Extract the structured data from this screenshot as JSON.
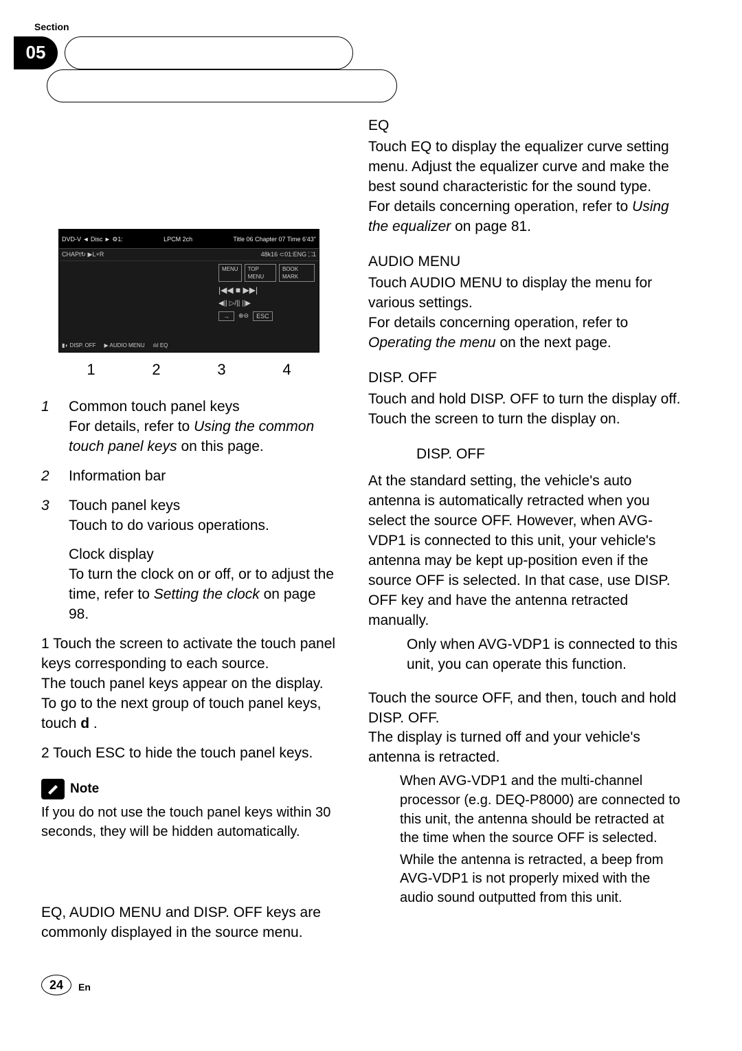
{
  "section_label": "Section",
  "section_number": "05",
  "labels": {
    "n1": "1",
    "n2": "2",
    "n3": "3",
    "n4": "4"
  },
  "left": {
    "l1_num": "1",
    "l1_line1": "Common touch panel keys",
    "l1_line2a": "For details, refer to ",
    "l1_line2b": "Using the common touch panel keys",
    "l1_line2c": " on this page.",
    "l2_num": "2",
    "l2": "Information bar",
    "l3_num": "3",
    "l3_line1": "Touch panel keys",
    "l3_line2": "Touch to do various operations.",
    "l4_line1": "Clock display",
    "l4_line2a": "To turn the clock on or off, or to adjust the time, refer to ",
    "l4_line2b": "Setting the clock",
    "l4_line2c": " on page 98.",
    "p1_a": "1    Touch the screen to activate the touch panel keys corresponding to each source.",
    "p1_b": "The touch panel keys appear on the display.",
    "p1_c_a": "      To go to the next group of touch panel keys, touch ",
    "p1_c_b": "d",
    "p1_c_c": "   .",
    "p2": "2    Touch ESC to hide the touch panel keys.",
    "note_label": "Note",
    "note_body": "If you do not use the touch panel keys within 30 seconds, they will be hidden automatically.",
    "common_keys": "EQ, AUDIO MENU  and DISP. OFF keys are commonly displayed in the source menu."
  },
  "right": {
    "eq_title": "EQ",
    "eq_body": "Touch EQ to display the equalizer curve setting menu. Adjust the equalizer curve and make the best sound characteristic for the sound type.",
    "eq_ref_a": "For details concerning operation, refer to ",
    "eq_ref_b": "Using the equalizer",
    "eq_ref_c": " on page 81.",
    "am_title": "AUDIO MENU",
    "am_body": "Touch AUDIO MENU  to display the menu for various settings.",
    "am_ref_a": "For details concerning operation, refer to ",
    "am_ref_b": "Operating the menu",
    "am_ref_c": " on the next page.",
    "do_title": "DISP. OFF",
    "do_body": "Touch and hold DISP. OFF to turn the display off. Touch the screen to turn the display on.",
    "sec2_title": "DISP. OFF",
    "sec2_p1": "At the standard setting, the vehicle's auto antenna is automatically retracted when you select the source OFF. However, when AVG-VDP1 is connected to this unit, your vehicle's antenna may be kept up-position even if the source OFF is selected. In that case, use DISP. OFF key and have the antenna retracted manually.",
    "sec2_b1": "Only when AVG-VDP1 is connected to this unit, you can operate this function.",
    "sec2_p2a": "     Touch the source OFF, and then, touch and hold DISP. OFF.",
    "sec2_p2b": "The display is turned off and your vehicle's antenna is retracted.",
    "sec2_li1": "When AVG-VDP1 and the multi-channel processor (e.g. DEQ-P8000) are connected to this unit, the antenna should be retracted at the time when the source OFF is selected.",
    "sec2_li2": "While the antenna is retracted, a beep from AVG-VDP1 is not properly mixed with the audio sound outputted from this unit."
  },
  "footer": {
    "page": "24",
    "lang": "En"
  }
}
